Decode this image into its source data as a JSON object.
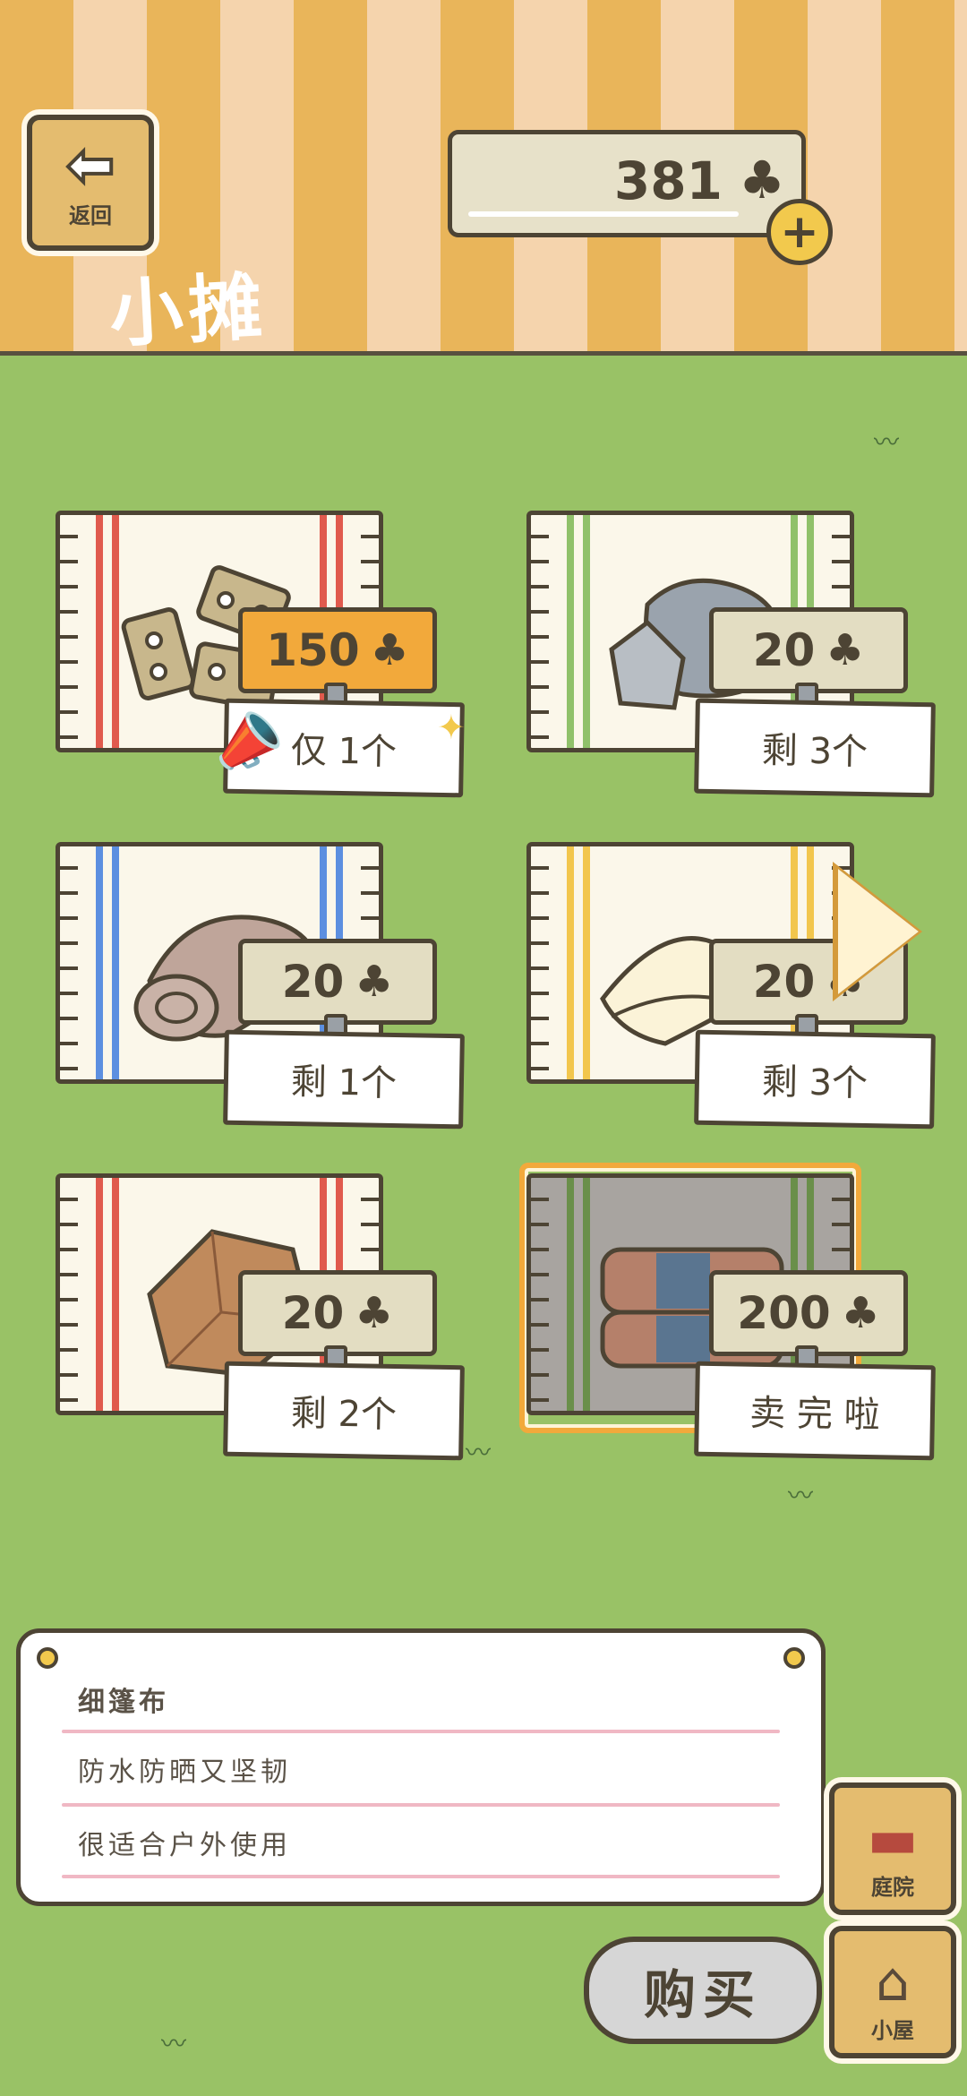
{
  "header": {
    "back_label": "返回",
    "title": "小摊",
    "clover_count": "381",
    "clover_symbol": "♣",
    "plus_symbol": "+"
  },
  "items": [
    {
      "price": "150",
      "stock": "仅 1个",
      "stripe_color": "#e05a4d",
      "tag_style": "gold",
      "art": "hinges"
    },
    {
      "price": "20",
      "stock": "剩 3个",
      "stripe_color": "#90c16a",
      "tag_style": "plain",
      "art": "stone"
    },
    {
      "price": "20",
      "stock": "剩 1个",
      "stripe_color": "#5c8fe0",
      "tag_style": "plain",
      "art": "cloth-roll"
    },
    {
      "price": "20",
      "stock": "剩 3个",
      "stripe_color": "#f2c64d",
      "tag_style": "plain",
      "art": "white-cloth"
    },
    {
      "price": "20",
      "stock": "剩 2个",
      "stripe_color": "#e05a4d",
      "tag_style": "plain",
      "art": "paper-bag"
    },
    {
      "price": "200",
      "stock": "卖 完 啦",
      "stripe_color": "#6a8f4a",
      "tag_style": "plain",
      "art": "striped-tarp",
      "selected": true
    }
  ],
  "description": {
    "name": "细篷布",
    "line1": "防水防晒又坚韧",
    "line2": "很适合户外使用"
  },
  "buttons": {
    "buy": "购买",
    "yard": "庭院",
    "house": "小屋"
  },
  "colors": {
    "ground": "#99c266",
    "stripe_orange": "#e9b55a",
    "stripe_cream": "#f5d4ad"
  }
}
